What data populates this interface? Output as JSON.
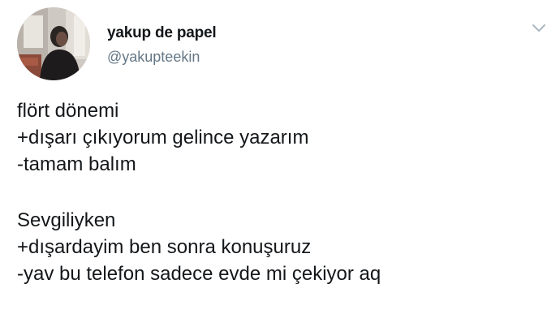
{
  "tweet": {
    "author": {
      "display_name": "yakup de papel",
      "handle": "@yakupteekin",
      "avatar_icon": "profile-photo-icon"
    },
    "menu_icon": "chevron-down-icon",
    "text_lines": [
      "flört dönemi",
      "+dışarı çıkıyorum gelince yazarım",
      "-tamam balım",
      "",
      "Sevgiliyken",
      "+dışardayim ben sonra konuşuruz",
      "-yav bu telefon sadece evde mi çekiyor aq"
    ]
  },
  "colors": {
    "text": "#14171a",
    "secondary": "#657786",
    "chevron": "#aab8c2"
  }
}
